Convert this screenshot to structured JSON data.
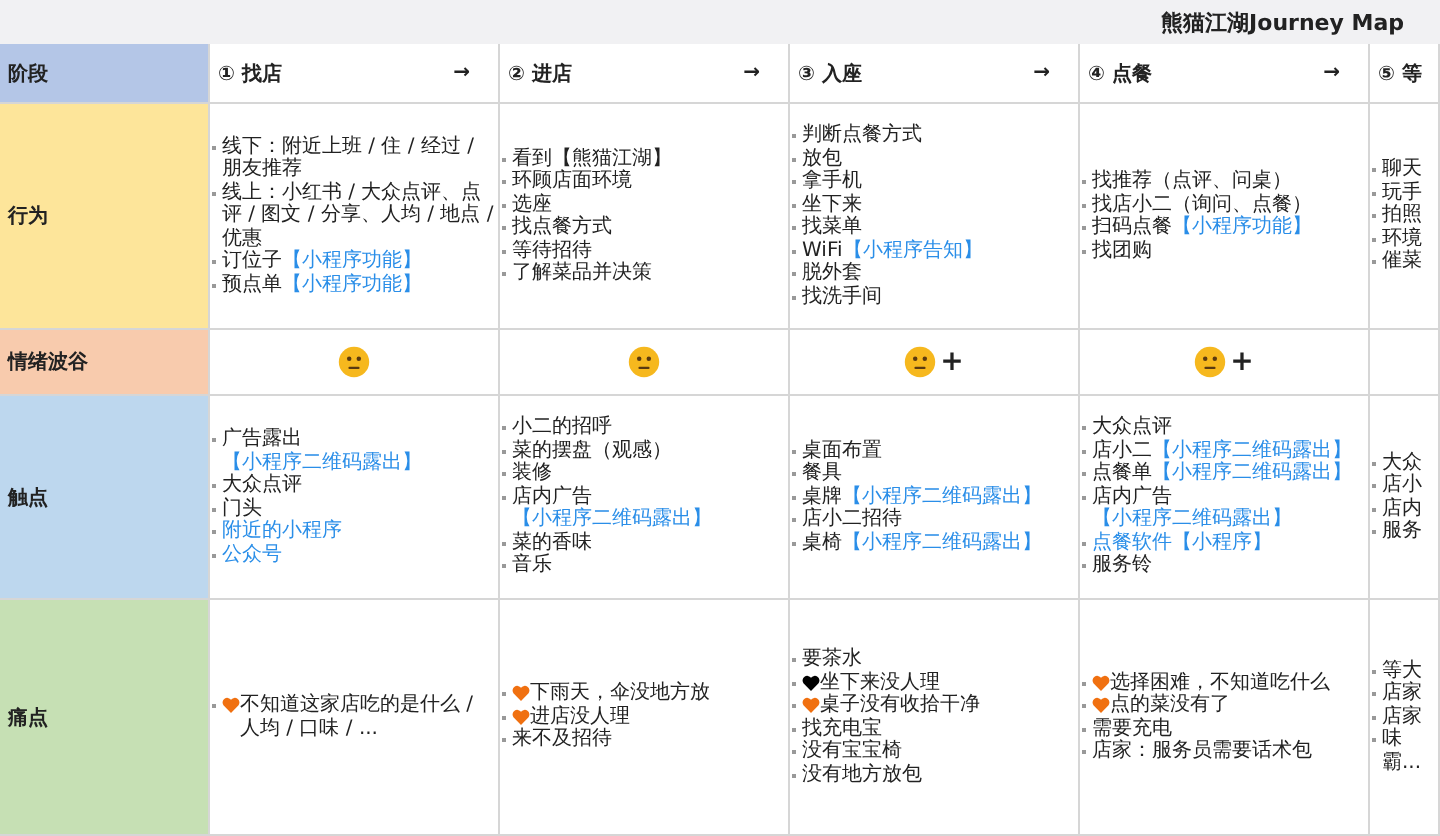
{
  "title": "熊猫江湖Journey Map",
  "header_label": "阶段",
  "stages": [
    {
      "label": "① 找店",
      "arrow": "→"
    },
    {
      "label": "② 进店",
      "arrow": "→"
    },
    {
      "label": "③ 入座",
      "arrow": "→"
    },
    {
      "label": "④ 点餐",
      "arrow": "→"
    },
    {
      "label": "⑤ 等"
    }
  ],
  "rows": [
    {
      "label": "行为",
      "color": "#fde59a",
      "kind": "list",
      "cells": [
        [
          {
            "text": "线下：附近上班 / 住 / 经过 / 朋友推荐"
          },
          {
            "text": "线上：小红书 / 大众点评、点评 / 图文 / 分享、人均 / 地点 / 优惠"
          },
          {
            "text": "订位子",
            "tag": "【小程序功能】"
          },
          {
            "text": "预点单",
            "tag": "【小程序功能】"
          }
        ],
        [
          {
            "text": "看到【熊猫江湖】"
          },
          {
            "text": "环顾店面环境"
          },
          {
            "text": "选座"
          },
          {
            "text": "找点餐方式"
          },
          {
            "text": "等待招待"
          },
          {
            "text": "了解菜品并决策"
          }
        ],
        [
          {
            "text": "判断点餐方式"
          },
          {
            "text": "放包"
          },
          {
            "text": "拿手机"
          },
          {
            "text": "坐下来"
          },
          {
            "text": "找菜单"
          },
          {
            "text": "WiFi",
            "tag": "【小程序告知】"
          },
          {
            "text": "脱外套"
          },
          {
            "text": "找洗手间"
          }
        ],
        [
          {
            "text": "找推荐（点评、问桌）"
          },
          {
            "text": "找店小二（询问、点餐）"
          },
          {
            "text": "扫码点餐",
            "tag": "【小程序功能】"
          },
          {
            "text": "找团购"
          }
        ],
        [
          {
            "text": "聊天"
          },
          {
            "text": "玩手"
          },
          {
            "text": "拍照"
          },
          {
            "text": "环境"
          },
          {
            "text": "催菜"
          }
        ]
      ]
    },
    {
      "label": "情绪波谷",
      "color": "#f8cbad",
      "kind": "emotion",
      "cells": [
        {
          "face": true
        },
        {
          "face": true
        },
        {
          "face": true,
          "extra": "+"
        },
        {
          "face": true,
          "extra": "+"
        },
        {
          "face": false
        }
      ]
    },
    {
      "label": "触点",
      "color": "#bdd7ee",
      "kind": "list",
      "cells": [
        [
          {
            "text": "广告露出",
            "tag": "【小程序二维码露出】"
          },
          {
            "text": "大众点评"
          },
          {
            "text": "门头"
          },
          {
            "text": "附近的小程序",
            "blue": true
          },
          {
            "text": "公众号",
            "blue": true
          }
        ],
        [
          {
            "text": "小二的招呼"
          },
          {
            "text": "菜的摆盘（观感）"
          },
          {
            "text": "装修"
          },
          {
            "text": "店内广告",
            "tag": "【小程序二维码露出】"
          },
          {
            "text": "菜的香味"
          },
          {
            "text": "音乐"
          }
        ],
        [
          {
            "text": "桌面布置"
          },
          {
            "text": "餐具"
          },
          {
            "text": "桌牌",
            "tag": "【小程序二维码露出】"
          },
          {
            "text": "店小二招待"
          },
          {
            "text": "桌椅",
            "tag": "【小程序二维码露出】"
          }
        ],
        [
          {
            "text": "大众点评"
          },
          {
            "text": "店小二",
            "tag": "【小程序二维码露出】"
          },
          {
            "text": "点餐单",
            "tag": "【小程序二维码露出】"
          },
          {
            "text": "店内广告",
            "tag": "【小程序二维码露出】"
          },
          {
            "text": "点餐软件【小程序】",
            "blue": true
          },
          {
            "text": "服务铃"
          }
        ],
        [
          {
            "text": "大众"
          },
          {
            "text": "店小"
          },
          {
            "text": "店内"
          },
          {
            "text": "服务"
          }
        ]
      ]
    },
    {
      "label": "痛点",
      "color": "#c6e0b4",
      "kind": "list",
      "cells": [
        [
          {
            "text": "不知道这家店吃的是什么 / 人均 / 口味 / ...",
            "color": "#f07010"
          }
        ],
        [
          {
            "text": "下雨天，伞没地方放",
            "color": "#f07010"
          },
          {
            "text": "进店没人理",
            "color": "#f07010"
          },
          {
            "text": "来不及招待"
          }
        ],
        [
          {
            "text": "要茶水"
          },
          {
            "text": "坐下来没人理",
            "color": "#000000"
          },
          {
            "text": "桌子没有收拾干净",
            "color": "#f07010"
          },
          {
            "text": "找充电宝"
          },
          {
            "text": "没有宝宝椅"
          },
          {
            "text": "没有地方放包"
          }
        ],
        [
          {
            "text": "选择困难，不知道吃什么",
            "color": "#f07010"
          },
          {
            "text": "点的菜没有了",
            "color": "#f07010"
          },
          {
            "text": "需要充电"
          },
          {
            "text": "店家：服务员需要话术包"
          }
        ],
        [
          {
            "text": "等大"
          },
          {
            "text": "店家"
          },
          {
            "text": "店家"
          },
          {
            "text": "味霸..."
          }
        ]
      ]
    }
  ]
}
